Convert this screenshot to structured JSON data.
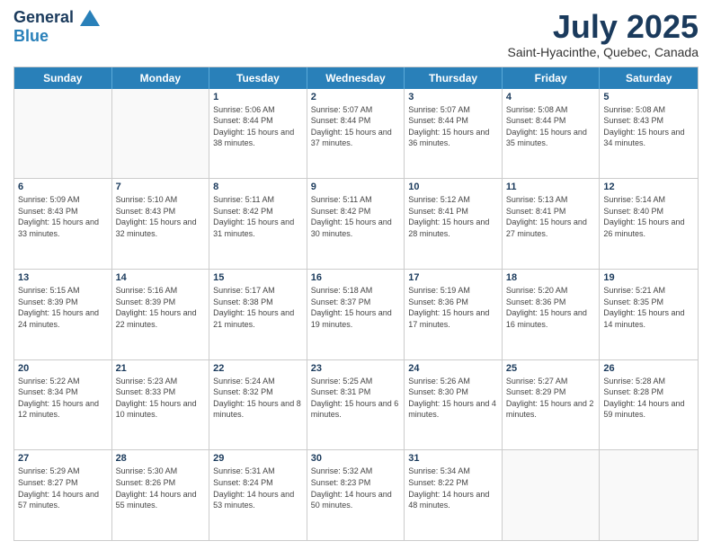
{
  "header": {
    "logo_line1": "General",
    "logo_line2": "Blue",
    "month": "July 2025",
    "location": "Saint-Hyacinthe, Quebec, Canada"
  },
  "day_headers": [
    "Sunday",
    "Monday",
    "Tuesday",
    "Wednesday",
    "Thursday",
    "Friday",
    "Saturday"
  ],
  "weeks": [
    [
      {
        "day": "",
        "info": ""
      },
      {
        "day": "",
        "info": ""
      },
      {
        "day": "1",
        "info": "Sunrise: 5:06 AM\nSunset: 8:44 PM\nDaylight: 15 hours and 38 minutes."
      },
      {
        "day": "2",
        "info": "Sunrise: 5:07 AM\nSunset: 8:44 PM\nDaylight: 15 hours and 37 minutes."
      },
      {
        "day": "3",
        "info": "Sunrise: 5:07 AM\nSunset: 8:44 PM\nDaylight: 15 hours and 36 minutes."
      },
      {
        "day": "4",
        "info": "Sunrise: 5:08 AM\nSunset: 8:44 PM\nDaylight: 15 hours and 35 minutes."
      },
      {
        "day": "5",
        "info": "Sunrise: 5:08 AM\nSunset: 8:43 PM\nDaylight: 15 hours and 34 minutes."
      }
    ],
    [
      {
        "day": "6",
        "info": "Sunrise: 5:09 AM\nSunset: 8:43 PM\nDaylight: 15 hours and 33 minutes."
      },
      {
        "day": "7",
        "info": "Sunrise: 5:10 AM\nSunset: 8:43 PM\nDaylight: 15 hours and 32 minutes."
      },
      {
        "day": "8",
        "info": "Sunrise: 5:11 AM\nSunset: 8:42 PM\nDaylight: 15 hours and 31 minutes."
      },
      {
        "day": "9",
        "info": "Sunrise: 5:11 AM\nSunset: 8:42 PM\nDaylight: 15 hours and 30 minutes."
      },
      {
        "day": "10",
        "info": "Sunrise: 5:12 AM\nSunset: 8:41 PM\nDaylight: 15 hours and 28 minutes."
      },
      {
        "day": "11",
        "info": "Sunrise: 5:13 AM\nSunset: 8:41 PM\nDaylight: 15 hours and 27 minutes."
      },
      {
        "day": "12",
        "info": "Sunrise: 5:14 AM\nSunset: 8:40 PM\nDaylight: 15 hours and 26 minutes."
      }
    ],
    [
      {
        "day": "13",
        "info": "Sunrise: 5:15 AM\nSunset: 8:39 PM\nDaylight: 15 hours and 24 minutes."
      },
      {
        "day": "14",
        "info": "Sunrise: 5:16 AM\nSunset: 8:39 PM\nDaylight: 15 hours and 22 minutes."
      },
      {
        "day": "15",
        "info": "Sunrise: 5:17 AM\nSunset: 8:38 PM\nDaylight: 15 hours and 21 minutes."
      },
      {
        "day": "16",
        "info": "Sunrise: 5:18 AM\nSunset: 8:37 PM\nDaylight: 15 hours and 19 minutes."
      },
      {
        "day": "17",
        "info": "Sunrise: 5:19 AM\nSunset: 8:36 PM\nDaylight: 15 hours and 17 minutes."
      },
      {
        "day": "18",
        "info": "Sunrise: 5:20 AM\nSunset: 8:36 PM\nDaylight: 15 hours and 16 minutes."
      },
      {
        "day": "19",
        "info": "Sunrise: 5:21 AM\nSunset: 8:35 PM\nDaylight: 15 hours and 14 minutes."
      }
    ],
    [
      {
        "day": "20",
        "info": "Sunrise: 5:22 AM\nSunset: 8:34 PM\nDaylight: 15 hours and 12 minutes."
      },
      {
        "day": "21",
        "info": "Sunrise: 5:23 AM\nSunset: 8:33 PM\nDaylight: 15 hours and 10 minutes."
      },
      {
        "day": "22",
        "info": "Sunrise: 5:24 AM\nSunset: 8:32 PM\nDaylight: 15 hours and 8 minutes."
      },
      {
        "day": "23",
        "info": "Sunrise: 5:25 AM\nSunset: 8:31 PM\nDaylight: 15 hours and 6 minutes."
      },
      {
        "day": "24",
        "info": "Sunrise: 5:26 AM\nSunset: 8:30 PM\nDaylight: 15 hours and 4 minutes."
      },
      {
        "day": "25",
        "info": "Sunrise: 5:27 AM\nSunset: 8:29 PM\nDaylight: 15 hours and 2 minutes."
      },
      {
        "day": "26",
        "info": "Sunrise: 5:28 AM\nSunset: 8:28 PM\nDaylight: 14 hours and 59 minutes."
      }
    ],
    [
      {
        "day": "27",
        "info": "Sunrise: 5:29 AM\nSunset: 8:27 PM\nDaylight: 14 hours and 57 minutes."
      },
      {
        "day": "28",
        "info": "Sunrise: 5:30 AM\nSunset: 8:26 PM\nDaylight: 14 hours and 55 minutes."
      },
      {
        "day": "29",
        "info": "Sunrise: 5:31 AM\nSunset: 8:24 PM\nDaylight: 14 hours and 53 minutes."
      },
      {
        "day": "30",
        "info": "Sunrise: 5:32 AM\nSunset: 8:23 PM\nDaylight: 14 hours and 50 minutes."
      },
      {
        "day": "31",
        "info": "Sunrise: 5:34 AM\nSunset: 8:22 PM\nDaylight: 14 hours and 48 minutes."
      },
      {
        "day": "",
        "info": ""
      },
      {
        "day": "",
        "info": ""
      }
    ]
  ]
}
